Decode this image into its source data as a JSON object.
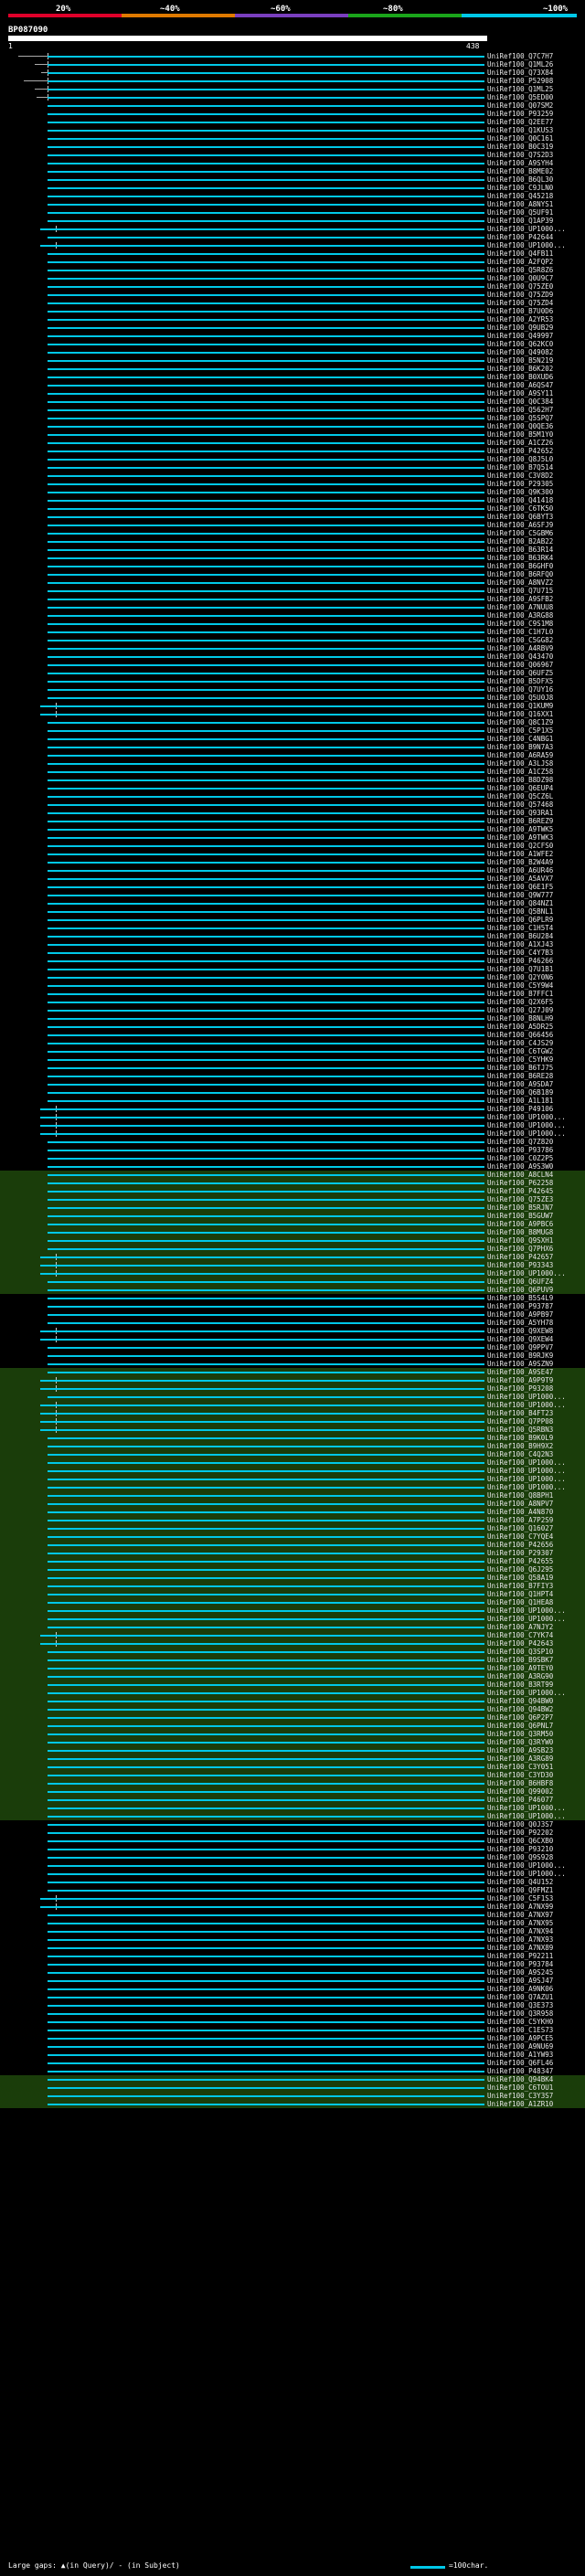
{
  "scale": {
    "labels": [
      "20%",
      "~40%",
      "~60%",
      "~80%",
      "~100%"
    ],
    "colors": [
      "#e0002a",
      "#e07a00",
      "#7a3fbf",
      "#1aa51a",
      "#00c8e8"
    ]
  },
  "query": {
    "id": "BP087090",
    "start": "1",
    "end": "438"
  },
  "footer": {
    "gap_text": "Large gaps: ▲(in Query)/ - (in Subject)",
    "scale_text": "=100char."
  },
  "hits": [
    "UniRef100_Q7C7H7",
    "UniRef100_Q1ML26",
    "UniRef100_Q73X84",
    "UniRef100_P52908",
    "UniRef100_Q1ML25",
    "UniRef100_Q5ED00",
    "UniRef100_Q07SM2",
    "UniRef100_P93259",
    "UniRef100_Q2EE77",
    "UniRef100_Q1KUS3",
    "UniRef100_Q0C161",
    "UniRef100_B0C319",
    "UniRef100_Q7S2D3",
    "UniRef100_A9SYH4",
    "UniRef100_B8ME02",
    "UniRef100_B6QL30",
    "UniRef100_C9JLN0",
    "UniRef100_Q45218",
    "UniRef100_A8NYS1",
    "UniRef100_Q5UF91",
    "UniRef100_Q1AP39",
    "UniRef100_UP1000...",
    "UniRef100_P42644",
    "UniRef100_UP1000...",
    "UniRef100_Q4FB11",
    "UniRef100_A2FQP2",
    "UniRef100_Q5R8Z6",
    "UniRef100_Q0U9C7",
    "UniRef100_Q75ZE0",
    "UniRef100_Q75ZD9",
    "UniRef100_Q75ZD4",
    "UniRef100_B7U0D6",
    "UniRef100_A2YR53",
    "UniRef100_Q9UB29",
    "UniRef100_Q49997",
    "UniRef100_Q62KC0",
    "UniRef100_Q49082",
    "UniRef100_B5N219",
    "UniRef100_B6K202",
    "UniRef100_B0XUD6",
    "UniRef100_A6QS47",
    "UniRef100_A9SY11",
    "UniRef100_Q0C384",
    "UniRef100_Q562H7",
    "UniRef100_Q5SPQ7",
    "UniRef100_Q0QE36",
    "UniRef100_B5M1Y0",
    "UniRef100_A1CZ26",
    "UniRef100_P42652",
    "UniRef100_Q8J5L0",
    "UniRef100_B7Q514",
    "UniRef100_C3V8D2",
    "UniRef100_P29305",
    "UniRef100_Q9K300",
    "UniRef100_Q41418",
    "UniRef100_C6TK50",
    "UniRef100_Q6BYT3",
    "UniRef100_A6SFJ9",
    "UniRef100_C5GBM6",
    "UniRef100_B2AB22",
    "UniRef100_B63R14",
    "UniRef100_B63RK4",
    "UniRef100_B6GHF0",
    "UniRef100_B6RFQ0",
    "UniRef100_A8NVZ2",
    "UniRef100_Q7U715",
    "UniRef100_A9SFB2",
    "UniRef100_A7NUU8",
    "UniRef100_A3RG88",
    "UniRef100_C9S1M8",
    "UniRef100_C1H7L0",
    "UniRef100_C5GG82",
    "UniRef100_A4RBV9",
    "UniRef100_Q43470",
    "UniRef100_Q06967",
    "UniRef100_Q6UFZ5",
    "UniRef100_B5DFX5",
    "UniRef100_Q7UY16",
    "UniRef100_Q5U0J8",
    "UniRef100_Q1KUM9",
    "UniRef100_Q16XX1",
    "UniRef100_Q8C1Z9",
    "UniRef100_C5P1X5",
    "UniRef100_C4NBG1",
    "UniRef100_B9N7A3",
    "UniRef100_A6RA59",
    "UniRef100_A3LJS8",
    "UniRef100_A1CZ58",
    "UniRef100_B8DZ98",
    "UniRef100_Q6EUP4",
    "UniRef100_Q5CZ6L",
    "UniRef100_Q57468",
    "UniRef100_Q93RA1",
    "UniRef100_B6REZ9",
    "UniRef100_A9TWK5",
    "UniRef100_A9TWK3",
    "UniRef100_Q2CFS0",
    "UniRef100_A1WFE2",
    "UniRef100_B2W4A9",
    "UniRef100_A6UR46",
    "UniRef100_A5AVX7",
    "UniRef100_Q6E1F5",
    "UniRef100_Q9W777",
    "UniRef100_Q84NZ1",
    "UniRef100_Q5BNL1",
    "UniRef100_Q6PLR9",
    "UniRef100_C1H5T4",
    "UniRef100_B6U284",
    "UniRef100_A1XJ43",
    "UniRef100_C4Y7B3",
    "UniRef100_P46266",
    "UniRef100_Q7U1B1",
    "UniRef100_Q2Y0N6",
    "UniRef100_C5Y9W4",
    "UniRef100_B7FFC1",
    "UniRef100_Q2X6F5",
    "UniRef100_Q27J09",
    "UniRef100_B8NLH9",
    "UniRef100_A5DR25",
    "UniRef100_Q66456",
    "UniRef100_C4JS29",
    "UniRef100_C6TGW2",
    "UniRef100_C5YHK9",
    "UniRef100_B6TJ75",
    "UniRef100_B6RE28",
    "UniRef100_A9SDA7",
    "UniRef100_Q6B189",
    "UniRef100_A1L181",
    "UniRef100_P49106",
    "UniRef100_UP1000...",
    "UniRef100_UP1000...",
    "UniRef100_UP1000...",
    "UniRef100_Q7Z820",
    "UniRef100_P93786",
    "UniRef100_C0Z2P5",
    "UniRef100_A9S3W0",
    "UniRef100_A8CLN4",
    "UniRef100_P62258",
    "UniRef100_P42645",
    "UniRef100_Q75ZE3",
    "UniRef100_B5RJN7",
    "UniRef100_B5GUW7",
    "UniRef100_A9PBC6",
    "UniRef100_B8MUG8",
    "UniRef100_Q9SXH1",
    "UniRef100_Q7PHX6",
    "UniRef100_P42657",
    "UniRef100_P93343",
    "UniRef100_UP1000...",
    "UniRef100_Q6UFZ4",
    "UniRef100_Q6PUV9",
    "UniRef100_B5S4L9",
    "UniRef100_P93787",
    "UniRef100_A9PB97",
    "UniRef100_A5YH78",
    "UniRef100_Q9XEW8",
    "UniRef100_Q9XEW4",
    "UniRef100_Q9PPV7",
    "UniRef100_B9RJK9",
    "UniRef100_A9SZN9",
    "UniRef100_A9SE47",
    "UniRef100_A9P9T9",
    "UniRef100_P93208",
    "UniRef100_UP1000...",
    "UniRef100_UP1000...",
    "UniRef100_B4FT23",
    "UniRef100_Q7PP08",
    "UniRef100_Q5RBN3",
    "UniRef100_B9K0L9",
    "UniRef100_B9H9X2",
    "UniRef100_C4Q2N3",
    "UniRef100_UP1000...",
    "UniRef100_UP1000...",
    "UniRef100_UP1000...",
    "UniRef100_UP1000...",
    "UniRef100_Q8BPH1",
    "UniRef100_A8NPV7",
    "UniRef100_A4N870",
    "UniRef100_A7P2S9",
    "UniRef100_Q16027",
    "UniRef100_C7YQE4",
    "UniRef100_P42656",
    "UniRef100_P29307",
    "UniRef100_P42655",
    "UniRef100_Q6J295",
    "UniRef100_Q58A19",
    "UniRef100_B7FIY3",
    "UniRef100_Q1HPT4",
    "UniRef100_Q1HEA8",
    "UniRef100_UP1000...",
    "UniRef100_UP1000...",
    "UniRef100_A7NJY2",
    "UniRef100_C7YK74",
    "UniRef100_P42643",
    "UniRef100_Q3SP10",
    "UniRef100_B9SBK7",
    "UniRef100_A9TEY0",
    "UniRef100_A3RG90",
    "UniRef100_B3RT99",
    "UniRef100_UP1000...",
    "UniRef100_Q94BW0",
    "UniRef100_Q94BW2",
    "UniRef100_Q6P2P7",
    "UniRef100_Q6PNL7",
    "UniRef100_Q3RM50",
    "UniRef100_Q3RYW0",
    "UniRef100_A9SB23",
    "UniRef100_A3RG89",
    "UniRef100_C3Y051",
    "UniRef100_C3YD30",
    "UniRef100_B6HBF8",
    "UniRef100_Q99002",
    "UniRef100_P46077",
    "UniRef100_UP1000...",
    "UniRef100_UP1000...",
    "UniRef100_Q0J3S7",
    "UniRef100_P92202",
    "UniRef100_Q6CXB0",
    "UniRef100_P93210",
    "UniRef100_Q9S928",
    "UniRef100_UP1000...",
    "UniRef100_UP1000...",
    "UniRef100_Q4U152",
    "UniRef100_Q9FMZ1",
    "UniRef100_C5F1S3",
    "UniRef100_A7NX99",
    "UniRef100_A7NX97",
    "UniRef100_A7NX95",
    "UniRef100_A7NX94",
    "UniRef100_A7NX93",
    "UniRef100_A7NX89",
    "UniRef100_P92211",
    "UniRef100_P93784",
    "UniRef100_A9S245",
    "UniRef100_A9SJ47",
    "UniRef100_A9NK06",
    "UniRef100_Q7AZU1",
    "UniRef100_Q3E373",
    "UniRef100_Q3R958",
    "UniRef100_C5YKH0",
    "UniRef100_C1ES73",
    "UniRef100_A9PCE5",
    "UniRef100_A9NU69",
    "UniRef100_A1YW93",
    "UniRef100_Q6FL46",
    "UniRef100_P48347",
    "UniRef100_Q94BK4",
    "UniRef100_C6TOU1",
    "UniRef100_C3Y3S7",
    "UniRef100_A1ZR10"
  ]
}
